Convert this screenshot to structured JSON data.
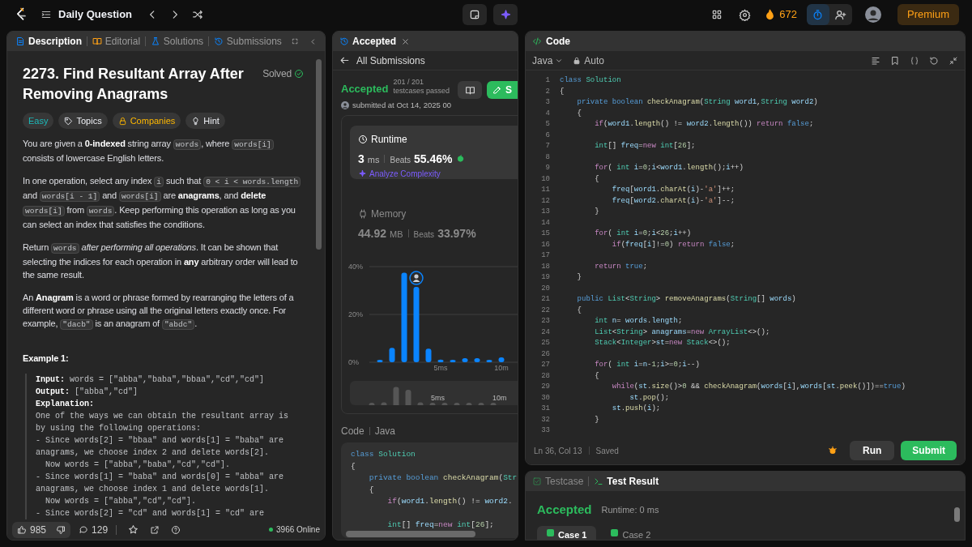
{
  "top_bar": {
    "title": "Daily Question",
    "streak": "672",
    "premium": "Premium"
  },
  "description_panel": {
    "tabs": [
      {
        "label": "Description",
        "selected": true
      },
      {
        "label": "Editorial",
        "selected": false
      },
      {
        "label": "Solutions",
        "selected": false
      },
      {
        "label": "Submissions",
        "selected": false
      }
    ],
    "title": "2273. Find Resultant Array After Removing Anagrams",
    "status": "Solved",
    "tags": [
      {
        "label": "Easy",
        "kind": "difficulty"
      },
      {
        "label": "Topics",
        "kind": "topics"
      },
      {
        "label": "Companies",
        "kind": "companies"
      },
      {
        "label": "Hint",
        "kind": "hint"
      }
    ],
    "paragraphs": [
      [
        {
          "text": "You are given a ",
          "kind": "plain"
        },
        {
          "text": "0-indexed",
          "kind": "bold"
        },
        {
          "text": " string array ",
          "kind": "plain"
        },
        {
          "text": "words",
          "kind": "code"
        },
        {
          "text": ", where ",
          "kind": "plain"
        },
        {
          "text": "words[i]",
          "kind": "code"
        },
        {
          "text": " consists of lowercase English letters.",
          "kind": "plain"
        }
      ],
      [
        {
          "text": "In one operation, select any index ",
          "kind": "plain"
        },
        {
          "text": "i",
          "kind": "code"
        },
        {
          "text": " such that ",
          "kind": "plain"
        },
        {
          "text": "0 < i < words.length",
          "kind": "code"
        },
        {
          "text": " and ",
          "kind": "plain"
        },
        {
          "text": "words[i - 1]",
          "kind": "code"
        },
        {
          "text": " and ",
          "kind": "plain"
        },
        {
          "text": "words[i]",
          "kind": "code"
        },
        {
          "text": " are ",
          "kind": "plain"
        },
        {
          "text": "anagrams",
          "kind": "bold"
        },
        {
          "text": ", and ",
          "kind": "plain"
        },
        {
          "text": "delete ",
          "kind": "bold"
        },
        {
          "text": "words[i]",
          "kind": "code"
        },
        {
          "text": " from ",
          "kind": "plain"
        },
        {
          "text": "words",
          "kind": "code"
        },
        {
          "text": ". Keep performing this operation as long as you can select an index that satisfies the conditions.",
          "kind": "plain"
        }
      ],
      [
        {
          "text": "Return ",
          "kind": "plain"
        },
        {
          "text": "words",
          "kind": "code"
        },
        {
          "text": " after performing all operations",
          "kind": "italic"
        },
        {
          "text": ". It can be shown that selecting the indices for each operation in ",
          "kind": "plain"
        },
        {
          "text": "any",
          "kind": "bold"
        },
        {
          "text": " arbitrary order will lead to the same result.",
          "kind": "plain"
        }
      ],
      [
        {
          "text": "An ",
          "kind": "plain"
        },
        {
          "text": "Anagram",
          "kind": "bold"
        },
        {
          "text": " is a word or phrase formed by rearranging the letters of a different word or phrase using all the original letters exactly once. For example, ",
          "kind": "plain"
        },
        {
          "text": "\"dacb\"",
          "kind": "code"
        },
        {
          "text": " is an anagram of ",
          "kind": "plain"
        },
        {
          "text": "\"abdc\"",
          "kind": "code"
        },
        {
          "text": ".",
          "kind": "plain"
        }
      ]
    ],
    "example_title": "Example 1:",
    "example_lines": [
      {
        "label": "Input:",
        "text": "words = [\"abba\",\"baba\",\"bbaa\",\"cd\",\"cd\"]"
      },
      {
        "label": "Output:",
        "text": "[\"abba\",\"cd\"]"
      },
      {
        "label": "Explanation:"
      },
      {
        "text": "One of the ways we can obtain the resultant array is"
      },
      {
        "text": "by using the following operations:"
      },
      {
        "text": "- Since words[2] = \"bbaa\" and words[1] = \"baba\" are"
      },
      {
        "text": "anagrams, we choose index 2 and delete words[2]."
      },
      {
        "text": "  Now words = [\"abba\",\"baba\",\"cd\",\"cd\"]."
      },
      {
        "text": "- Since words[1] = \"baba\" and words[0] = \"abba\" are"
      },
      {
        "text": "anagrams, we choose index 1 and delete words[1]."
      },
      {
        "text": "  Now words = [\"abba\",\"cd\",\"cd\"]."
      },
      {
        "text": "- Since words[2] = \"cd\" and words[1] = \"cd\" are"
      }
    ],
    "footer": {
      "likes": "985",
      "comments": "129",
      "online": "3966 Online"
    }
  },
  "submission_panel": {
    "tab": "Accepted",
    "back": "All Submissions",
    "status": "Accepted",
    "passed": "201 / 201",
    "passed_label": "testcases passed",
    "submitted": "submitted at Oct 14, 2025 00",
    "button_label": "S",
    "metrics": [
      {
        "title": "Runtime",
        "value": "3",
        "unit": "ms",
        "beats_label": "Beats",
        "beats": "55.46%",
        "action": "Analyze Complexity",
        "selected": true
      },
      {
        "title": "Memory",
        "value": "44.92",
        "unit": "MB",
        "beats_label": "Beats",
        "beats": "33.97%",
        "selected": false
      }
    ],
    "chart_data": {
      "type": "bar",
      "x": [
        0,
        1,
        2,
        3,
        4,
        5,
        6,
        7,
        8,
        9,
        10
      ],
      "values": [
        1,
        6,
        37.5,
        31.5,
        5.7,
        1.1,
        1,
        1.7,
        1.7,
        1,
        2
      ],
      "yticks": [
        {
          "value": 0,
          "label": "0%"
        },
        {
          "value": 20,
          "label": "20%"
        },
        {
          "value": 40,
          "label": "40%"
        }
      ],
      "xticks": [
        {
          "value": 5,
          "label": "5ms"
        },
        {
          "value": 10,
          "label": "10m"
        }
      ],
      "xlim": [
        -0.8667,
        11.9333
      ],
      "ylim": [
        0,
        40
      ]
    },
    "overview_labels": [
      "5ms",
      "10m"
    ],
    "code_header": [
      "Code",
      "Java"
    ],
    "code_lines": [
      {
        "segments": [
          {
            "text": "class",
            "kind": "k"
          },
          {
            "text": " Solution",
            "kind": "t"
          }
        ]
      },
      {
        "segments": [
          {
            "text": "{",
            "kind": "p"
          }
        ]
      },
      {
        "segments": [
          {
            "text": "    private boolean",
            "kind": "k"
          },
          {
            "text": " checkAnagram",
            "kind": "f"
          },
          {
            "text": "(",
            "kind": "p"
          },
          {
            "text": "Str",
            "kind": "t"
          }
        ]
      },
      {
        "segments": [
          {
            "text": "    {",
            "kind": "p"
          }
        ]
      },
      {
        "segments": [
          {
            "text": "        if",
            "kind": "c"
          },
          {
            "text": "(",
            "kind": "p"
          },
          {
            "text": "word1",
            "kind": "v"
          },
          {
            "text": ".",
            "kind": "p"
          },
          {
            "text": "length",
            "kind": "f"
          },
          {
            "text": "() != ",
            "kind": "p"
          },
          {
            "text": "word2",
            "kind": "v"
          },
          {
            "text": ".",
            "kind": "p"
          }
        ]
      },
      {
        "gap_before": true,
        "segments": [
          {
            "text": "        int",
            "kind": "t"
          },
          {
            "text": "[] ",
            "kind": "p"
          },
          {
            "text": "freq",
            "kind": "v"
          },
          {
            "text": "=",
            "kind": "p"
          },
          {
            "text": "new",
            "kind": "c"
          },
          {
            "text": " int",
            "kind": "t"
          },
          {
            "text": "[",
            "kind": "p"
          },
          {
            "text": "26",
            "kind": "n"
          },
          {
            "text": "];",
            "kind": "p"
          }
        ]
      }
    ]
  },
  "editor": {
    "title": "Code",
    "language": "Java",
    "mode": "Auto",
    "lines": [
      {
        "n": "1",
        "segments": [
          {
            "text": "class",
            "kind": "k"
          },
          {
            "text": " Solution",
            "kind": "t"
          }
        ]
      },
      {
        "n": "2",
        "segments": [
          {
            "text": "{",
            "kind": "p"
          }
        ]
      },
      {
        "n": "3",
        "segments": [
          {
            "text": "    private boolean",
            "kind": "k"
          },
          {
            "text": " checkAnagram",
            "kind": "f"
          },
          {
            "text": "(",
            "kind": "p"
          },
          {
            "text": "String",
            "kind": "t"
          },
          {
            "text": " word1",
            "kind": "v"
          },
          {
            "text": ",",
            "kind": "p"
          },
          {
            "text": "String",
            "kind": "t"
          },
          {
            "text": " word2",
            "kind": "v"
          },
          {
            "text": ")",
            "kind": "p"
          }
        ]
      },
      {
        "n": "4",
        "segments": [
          {
            "text": "    {",
            "kind": "p"
          }
        ]
      },
      {
        "n": "5",
        "segments": [
          {
            "text": "        if",
            "kind": "c"
          },
          {
            "text": "(",
            "kind": "p"
          },
          {
            "text": "word1",
            "kind": "v"
          },
          {
            "text": ".",
            "kind": "p"
          },
          {
            "text": "length",
            "kind": "f"
          },
          {
            "text": "() != ",
            "kind": "p"
          },
          {
            "text": "word2",
            "kind": "v"
          },
          {
            "text": ".",
            "kind": "p"
          },
          {
            "text": "length",
            "kind": "f"
          },
          {
            "text": "()) ",
            "kind": "p"
          },
          {
            "text": "return",
            "kind": "c"
          },
          {
            "text": " false",
            "kind": "k"
          },
          {
            "text": ";",
            "kind": "p"
          }
        ]
      },
      {
        "n": "6"
      },
      {
        "n": "7",
        "segments": [
          {
            "text": "        int",
            "kind": "t"
          },
          {
            "text": "[] ",
            "kind": "p"
          },
          {
            "text": "freq",
            "kind": "v"
          },
          {
            "text": "=",
            "kind": "p"
          },
          {
            "text": "new",
            "kind": "c"
          },
          {
            "text": " int",
            "kind": "t"
          },
          {
            "text": "[",
            "kind": "p"
          },
          {
            "text": "26",
            "kind": "n"
          },
          {
            "text": "];",
            "kind": "p"
          }
        ]
      },
      {
        "n": "8"
      },
      {
        "n": "9",
        "segments": [
          {
            "text": "        for",
            "kind": "c"
          },
          {
            "text": "( ",
            "kind": "p"
          },
          {
            "text": "int",
            "kind": "t"
          },
          {
            "text": " i",
            "kind": "v"
          },
          {
            "text": "=",
            "kind": "p"
          },
          {
            "text": "0",
            "kind": "n"
          },
          {
            "text": ";",
            "kind": "p"
          },
          {
            "text": "i",
            "kind": "v"
          },
          {
            "text": "<",
            "kind": "p"
          },
          {
            "text": "word1",
            "kind": "v"
          },
          {
            "text": ".",
            "kind": "p"
          },
          {
            "text": "length",
            "kind": "f"
          },
          {
            "text": "();",
            "kind": "p"
          },
          {
            "text": "i",
            "kind": "v"
          },
          {
            "text": "++)",
            "kind": "p"
          }
        ]
      },
      {
        "n": "10",
        "segments": [
          {
            "text": "        {",
            "kind": "p"
          }
        ]
      },
      {
        "n": "11",
        "segments": [
          {
            "text": "            freq",
            "kind": "v"
          },
          {
            "text": "[",
            "kind": "p"
          },
          {
            "text": "word1",
            "kind": "v"
          },
          {
            "text": ".",
            "kind": "p"
          },
          {
            "text": "charAt",
            "kind": "f"
          },
          {
            "text": "(",
            "kind": "p"
          },
          {
            "text": "i",
            "kind": "v"
          },
          {
            "text": ")-",
            "kind": "p"
          },
          {
            "text": "'a'",
            "kind": "s"
          },
          {
            "text": "]++;",
            "kind": "p"
          }
        ]
      },
      {
        "n": "12",
        "segments": [
          {
            "text": "            freq",
            "kind": "v"
          },
          {
            "text": "[",
            "kind": "p"
          },
          {
            "text": "word2",
            "kind": "v"
          },
          {
            "text": ".",
            "kind": "p"
          },
          {
            "text": "charAt",
            "kind": "f"
          },
          {
            "text": "(",
            "kind": "p"
          },
          {
            "text": "i",
            "kind": "v"
          },
          {
            "text": ")-",
            "kind": "p"
          },
          {
            "text": "'a'",
            "kind": "s"
          },
          {
            "text": "]--;",
            "kind": "p"
          }
        ]
      },
      {
        "n": "13",
        "segments": [
          {
            "text": "        }",
            "kind": "p"
          }
        ]
      },
      {
        "n": "14"
      },
      {
        "n": "15",
        "segments": [
          {
            "text": "        for",
            "kind": "c"
          },
          {
            "text": "( ",
            "kind": "p"
          },
          {
            "text": "int",
            "kind": "t"
          },
          {
            "text": " i",
            "kind": "v"
          },
          {
            "text": "=",
            "kind": "p"
          },
          {
            "text": "0",
            "kind": "n"
          },
          {
            "text": ";",
            "kind": "p"
          },
          {
            "text": "i",
            "kind": "v"
          },
          {
            "text": "<",
            "kind": "p"
          },
          {
            "text": "26",
            "kind": "n"
          },
          {
            "text": ";",
            "kind": "p"
          },
          {
            "text": "i",
            "kind": "v"
          },
          {
            "text": "++)",
            "kind": "p"
          }
        ]
      },
      {
        "n": "16",
        "segments": [
          {
            "text": "            if",
            "kind": "c"
          },
          {
            "text": "(",
            "kind": "p"
          },
          {
            "text": "freq",
            "kind": "v"
          },
          {
            "text": "[",
            "kind": "p"
          },
          {
            "text": "i",
            "kind": "v"
          },
          {
            "text": "]!=",
            "kind": "p"
          },
          {
            "text": "0",
            "kind": "n"
          },
          {
            "text": ") ",
            "kind": "p"
          },
          {
            "text": "return",
            "kind": "c"
          },
          {
            "text": " false",
            "kind": "k"
          },
          {
            "text": ";",
            "kind": "p"
          }
        ]
      },
      {
        "n": "17"
      },
      {
        "n": "18",
        "segments": [
          {
            "text": "        return",
            "kind": "c"
          },
          {
            "text": " true",
            "kind": "k"
          },
          {
            "text": ";",
            "kind": "p"
          }
        ]
      },
      {
        "n": "19",
        "segments": [
          {
            "text": "    }",
            "kind": "p"
          }
        ]
      },
      {
        "n": "20"
      },
      {
        "n": "21",
        "segments": [
          {
            "text": "    public",
            "kind": "k"
          },
          {
            "text": " List",
            "kind": "t"
          },
          {
            "text": "<",
            "kind": "p"
          },
          {
            "text": "String",
            "kind": "t"
          },
          {
            "text": "> ",
            "kind": "p"
          },
          {
            "text": "removeAnagrams",
            "kind": "f"
          },
          {
            "text": "(",
            "kind": "p"
          },
          {
            "text": "String",
            "kind": "t"
          },
          {
            "text": "[] ",
            "kind": "p"
          },
          {
            "text": "words",
            "kind": "v"
          },
          {
            "text": ")",
            "kind": "p"
          }
        ]
      },
      {
        "n": "22",
        "segments": [
          {
            "text": "    {",
            "kind": "p"
          }
        ]
      },
      {
        "n": "23",
        "segments": [
          {
            "text": "        int",
            "kind": "t"
          },
          {
            "text": " n",
            "kind": "v"
          },
          {
            "text": "= ",
            "kind": "p"
          },
          {
            "text": "words",
            "kind": "v"
          },
          {
            "text": ".",
            "kind": "p"
          },
          {
            "text": "length",
            "kind": "v"
          },
          {
            "text": ";",
            "kind": "p"
          }
        ]
      },
      {
        "n": "24",
        "segments": [
          {
            "text": "        List",
            "kind": "t"
          },
          {
            "text": "<",
            "kind": "p"
          },
          {
            "text": "String",
            "kind": "t"
          },
          {
            "text": "> ",
            "kind": "p"
          },
          {
            "text": "anagrams",
            "kind": "v"
          },
          {
            "text": "=",
            "kind": "p"
          },
          {
            "text": "new",
            "kind": "c"
          },
          {
            "text": " ArrayList",
            "kind": "t"
          },
          {
            "text": "<>();",
            "kind": "p"
          }
        ]
      },
      {
        "n": "25",
        "segments": [
          {
            "text": "        Stack",
            "kind": "t"
          },
          {
            "text": "<",
            "kind": "p"
          },
          {
            "text": "Integer",
            "kind": "t"
          },
          {
            "text": ">",
            "kind": "p"
          },
          {
            "text": "st",
            "kind": "v"
          },
          {
            "text": "=",
            "kind": "p"
          },
          {
            "text": "new",
            "kind": "c"
          },
          {
            "text": " Stack",
            "kind": "t"
          },
          {
            "text": "<>();",
            "kind": "p"
          }
        ]
      },
      {
        "n": "26"
      },
      {
        "n": "27",
        "segments": [
          {
            "text": "        for",
            "kind": "c"
          },
          {
            "text": "( ",
            "kind": "p"
          },
          {
            "text": "int",
            "kind": "t"
          },
          {
            "text": " i",
            "kind": "v"
          },
          {
            "text": "=",
            "kind": "p"
          },
          {
            "text": "n",
            "kind": "v"
          },
          {
            "text": "-",
            "kind": "p"
          },
          {
            "text": "1",
            "kind": "n"
          },
          {
            "text": ";",
            "kind": "p"
          },
          {
            "text": "i",
            "kind": "v"
          },
          {
            "text": ">=",
            "kind": "p"
          },
          {
            "text": "0",
            "kind": "n"
          },
          {
            "text": ";",
            "kind": "p"
          },
          {
            "text": "i",
            "kind": "v"
          },
          {
            "text": "--)",
            "kind": "p"
          }
        ]
      },
      {
        "n": "28",
        "segments": [
          {
            "text": "        {",
            "kind": "p"
          }
        ]
      },
      {
        "n": "29",
        "segments": [
          {
            "text": "            while",
            "kind": "c"
          },
          {
            "text": "(",
            "kind": "p"
          },
          {
            "text": "st",
            "kind": "v"
          },
          {
            "text": ".",
            "kind": "p"
          },
          {
            "text": "size",
            "kind": "f"
          },
          {
            "text": "()>",
            "kind": "p"
          },
          {
            "text": "0",
            "kind": "n"
          },
          {
            "text": " && ",
            "kind": "p"
          },
          {
            "text": "checkAnagram",
            "kind": "f"
          },
          {
            "text": "(",
            "kind": "p"
          },
          {
            "text": "words",
            "kind": "v"
          },
          {
            "text": "[",
            "kind": "p"
          },
          {
            "text": "i",
            "kind": "v"
          },
          {
            "text": "],",
            "kind": "p"
          },
          {
            "text": "words",
            "kind": "v"
          },
          {
            "text": "[",
            "kind": "p"
          },
          {
            "text": "st",
            "kind": "v"
          },
          {
            "text": ".",
            "kind": "p"
          },
          {
            "text": "peek",
            "kind": "f"
          },
          {
            "text": "()])==",
            "kind": "p"
          },
          {
            "text": "true",
            "kind": "k"
          },
          {
            "text": ")",
            "kind": "p"
          }
        ]
      },
      {
        "n": "30",
        "segments": [
          {
            "text": "                st",
            "kind": "v"
          },
          {
            "text": ".",
            "kind": "p"
          },
          {
            "text": "pop",
            "kind": "f"
          },
          {
            "text": "();",
            "kind": "p"
          }
        ]
      },
      {
        "n": "31",
        "segments": [
          {
            "text": "            st",
            "kind": "v"
          },
          {
            "text": ".",
            "kind": "p"
          },
          {
            "text": "push",
            "kind": "f"
          },
          {
            "text": "(",
            "kind": "p"
          },
          {
            "text": "i",
            "kind": "v"
          },
          {
            "text": ");",
            "kind": "p"
          }
        ]
      },
      {
        "n": "32",
        "segments": [
          {
            "text": "        }",
            "kind": "p"
          }
        ]
      },
      {
        "n": "33"
      }
    ],
    "cursor": "Ln 36, Col 13",
    "save_state": "Saved",
    "run": "Run",
    "submit": "Submit"
  },
  "console": {
    "tabs": [
      {
        "label": "Testcase",
        "selected": false
      },
      {
        "label": "Test Result",
        "selected": true
      }
    ],
    "status": "Accepted",
    "runtime": "Runtime: 0 ms",
    "cases": [
      {
        "label": "Case 1",
        "selected": true,
        "passed": true
      },
      {
        "label": "Case 2",
        "selected": false,
        "passed": true
      }
    ]
  }
}
